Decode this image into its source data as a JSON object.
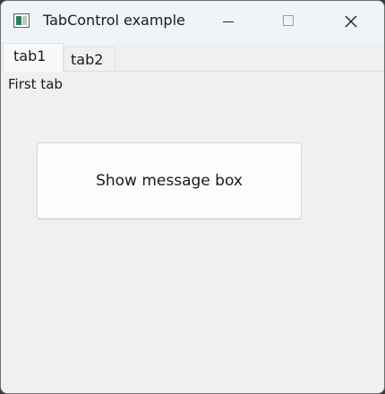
{
  "window": {
    "title": "TabControl example",
    "app_icon": "app-window-icon",
    "controls": {
      "minimize_icon": "minimize-icon",
      "maximize_icon": "maximize-icon",
      "close_icon": "close-icon"
    }
  },
  "tabs": [
    {
      "label": "tab1",
      "selected": true
    },
    {
      "label": "tab2",
      "selected": false
    }
  ],
  "panel": {
    "label": "First tab",
    "button_label": "Show message box"
  },
  "colors": {
    "titlebar": "#eff4f9",
    "window_bg": "#f0f0f0",
    "button_bg": "#fdfdfd"
  }
}
